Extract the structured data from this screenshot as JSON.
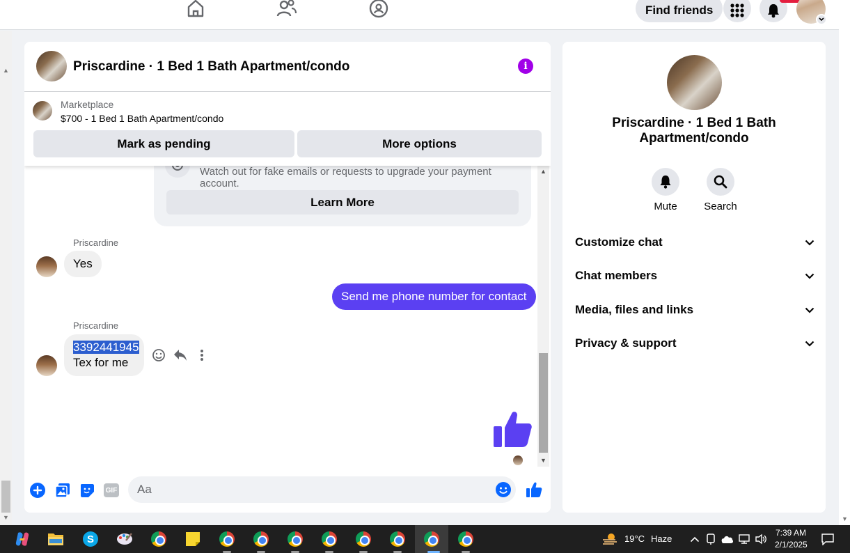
{
  "topbar": {
    "find_friends": "Find friends"
  },
  "chat": {
    "title": "Priscardine · 1 Bed 1 Bath Apartment/condo",
    "listing": {
      "source": "Marketplace",
      "price_line": "$700 - 1 Bed 1 Bath Apartment/condo",
      "mark_pending": "Mark as pending",
      "more_options": "More options"
    },
    "scam_notice": {
      "text": "Watch out for fake emails or requests to upgrade your payment account.",
      "learn_more": "Learn More"
    },
    "messages": [
      {
        "sender": "Priscardine",
        "text": "Yes"
      },
      {
        "text": "Send me phone number for contact"
      },
      {
        "sender": "Priscardine",
        "line1": "3392441945",
        "line2": "Tex for me"
      }
    ],
    "composer": {
      "placeholder": "Aa"
    }
  },
  "info_panel": {
    "title": "Priscardine · 1 Bed 1 Bath Apartment/condo",
    "mute": "Mute",
    "search": "Search",
    "sections": [
      "Customize chat",
      "Chat members",
      "Media, files and links",
      "Privacy & support"
    ]
  },
  "taskbar": {
    "weather_temp": "19°C",
    "weather_desc": "Haze",
    "time": "7:39 AM",
    "date": "2/1/2025"
  },
  "colors": {
    "accent": "#5b40f2",
    "messenger_blue": "#0866ff",
    "info_purple": "#a100e8"
  }
}
